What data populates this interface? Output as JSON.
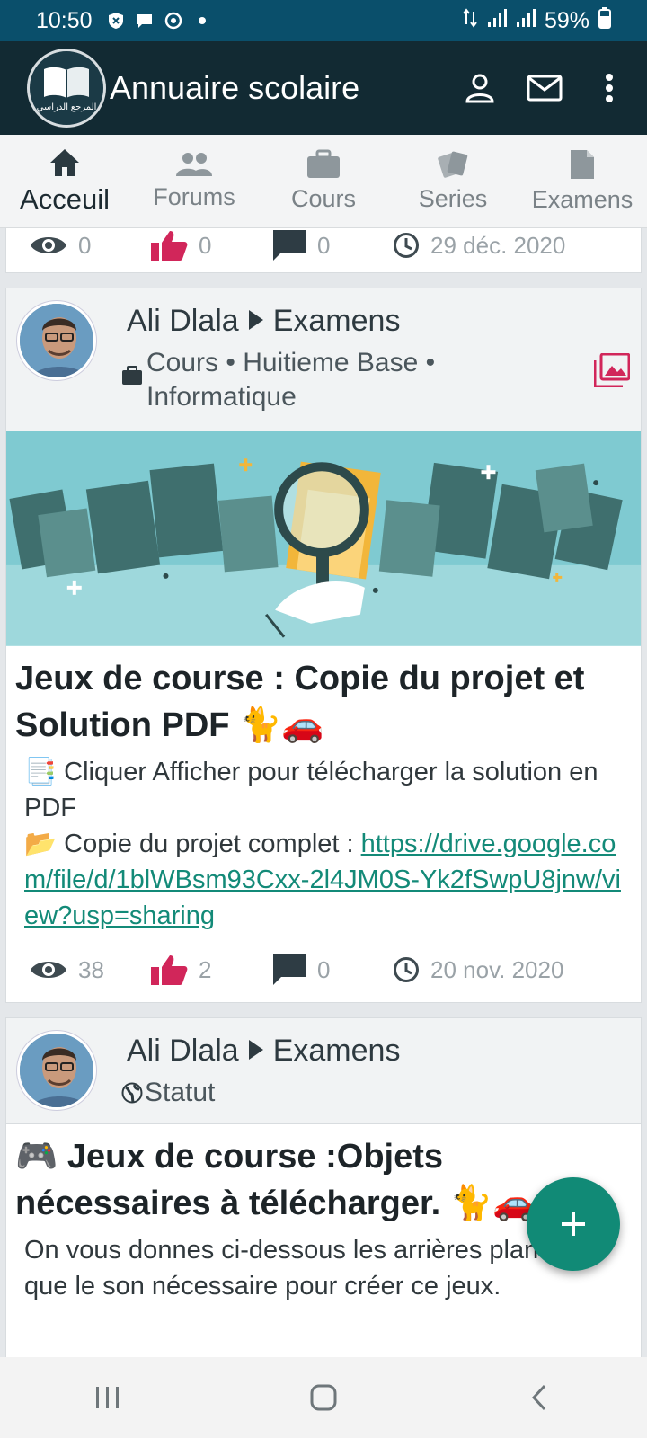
{
  "status_bar": {
    "time": "10:50",
    "battery": "59%"
  },
  "app_bar": {
    "title": "Annuaire scolaire",
    "logo_caption": "المرجع الدراسي"
  },
  "tabs": [
    {
      "label": "Acceuil",
      "icon": "home-icon",
      "active": true
    },
    {
      "label": "Forums",
      "icon": "people-icon",
      "active": false
    },
    {
      "label": "Cours",
      "icon": "briefcase-icon",
      "active": false
    },
    {
      "label": "Series",
      "icon": "cards-icon",
      "active": false
    },
    {
      "label": "Examens",
      "icon": "document-icon",
      "active": false
    }
  ],
  "posts": [
    {
      "stats": {
        "views": "0",
        "likes": "0",
        "comments": "0",
        "date": "29 déc. 2020"
      }
    },
    {
      "author": "Ali Dlala",
      "category": "Examens",
      "subtitle": "Cours • Huitieme Base • Informatique",
      "title": "Jeux de course : Copie du projet et Solution PDF 🐈🚗",
      "body_line1": "📑 Cliquer Afficher pour télécharger la solution en PDF",
      "body_line2_prefix": "📂 Copie du projet complet : ",
      "body_link": "https://drive.google.com/file/d/1blWBsm93Cxx-2l4JM0S-Yk2fSwpU8jnw/view?usp=sharing",
      "stats": {
        "views": "38",
        "likes": "2",
        "comments": "0",
        "date": "20 nov. 2020"
      }
    },
    {
      "author": "Ali Dlala",
      "category": "Examens",
      "subtitle": "Statut",
      "title": "🎮 Jeux de course :Objets nécessaires à télécharger. 🐈🚗",
      "body": "On vous donnes ci-dessous les arrières plan ainsi que le son nécessaire pour créer ce jeux."
    }
  ],
  "colors": {
    "accent": "#118a76",
    "appbar": "#122a33",
    "statusbar": "#0a4f6b",
    "like": "#d1265a"
  }
}
